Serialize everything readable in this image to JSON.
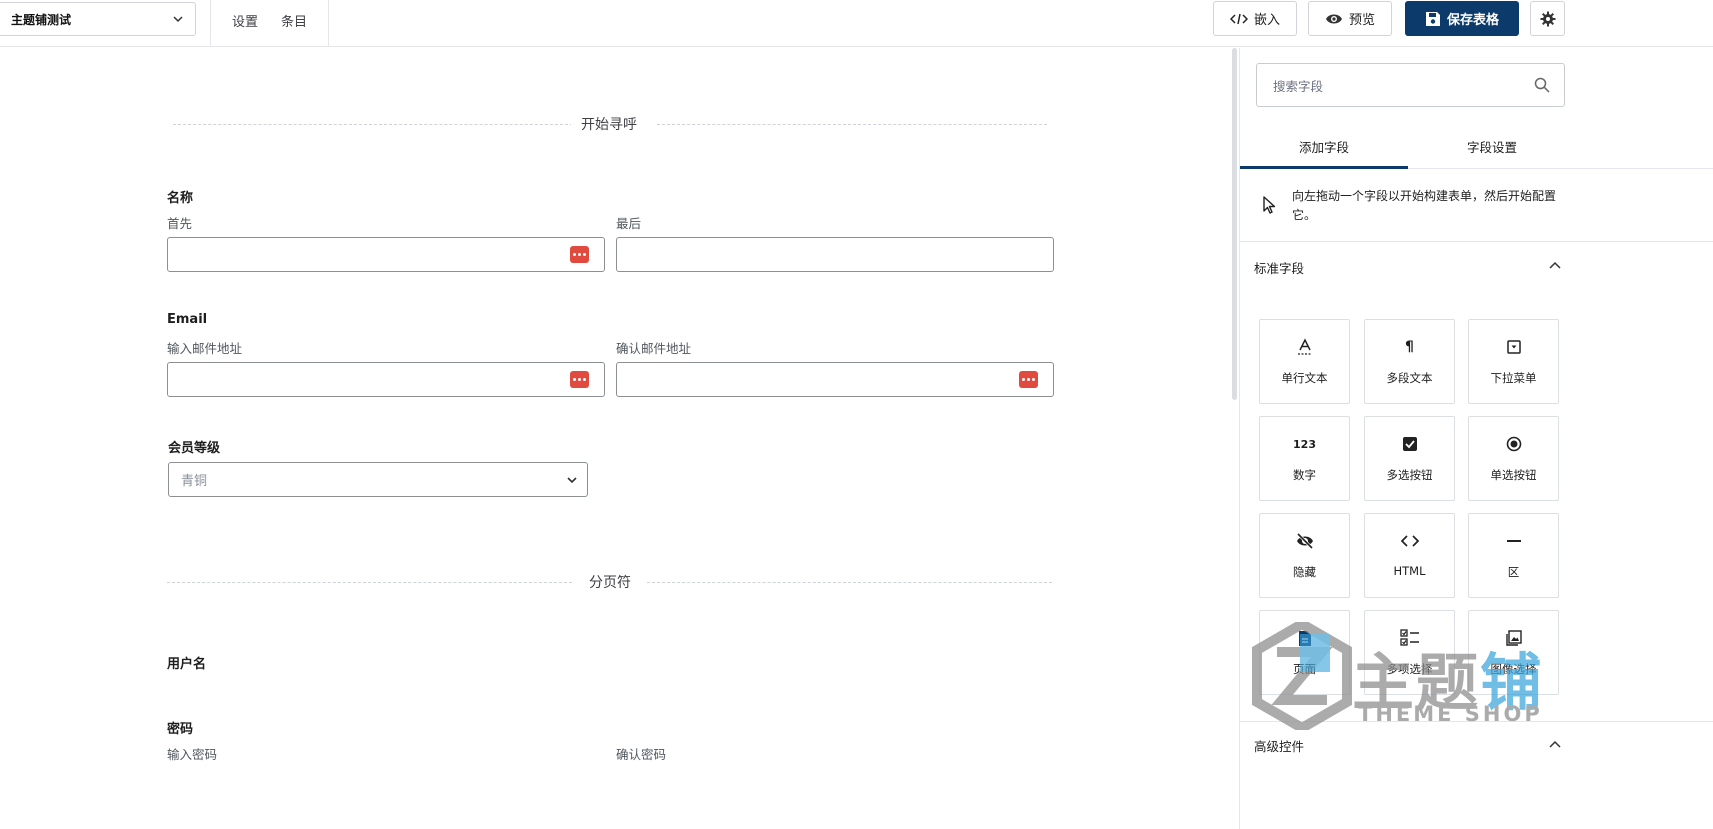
{
  "topbar": {
    "form_name": "主题铺测试",
    "nav": [
      "设置",
      "条目"
    ],
    "embed_label": "嵌入",
    "preview_label": "预览",
    "save_label": "保存表格"
  },
  "canvas": {
    "section_title": "开始寻呼",
    "name": {
      "label": "名称",
      "first": "首先",
      "last": "最后"
    },
    "email": {
      "label": "Email",
      "enter": "输入邮件地址",
      "confirm": "确认邮件地址"
    },
    "membership": {
      "label": "会员等级",
      "selected": "青铜"
    },
    "page_break": "分页符",
    "username": {
      "label": "用户名"
    },
    "password": {
      "label": "密码",
      "enter": "输入密码",
      "confirm": "确认密码"
    }
  },
  "sidebar": {
    "search_placeholder": "搜索字段",
    "tabs": [
      "添加字段",
      "字段设置"
    ],
    "hint": "向左拖动一个字段以开始构建表单，然后开始配置它。",
    "standard_title": "标准字段",
    "advanced_title": "高级控件",
    "fields": [
      {
        "label": "单行文本",
        "icon": "single-line-text-icon"
      },
      {
        "label": "多段文本",
        "icon": "paragraph-icon"
      },
      {
        "label": "下拉菜单",
        "icon": "dropdown-icon"
      },
      {
        "label": "数字",
        "icon": "number-icon",
        "glyph": "123"
      },
      {
        "label": "多选按钮",
        "icon": "checkbox-icon"
      },
      {
        "label": "单选按钮",
        "icon": "radio-icon"
      },
      {
        "label": "隐藏",
        "icon": "hidden-eye-icon"
      },
      {
        "label": "HTML",
        "icon": "code-icon"
      },
      {
        "label": "区",
        "icon": "section-icon"
      },
      {
        "label": "页面",
        "icon": "page-icon"
      },
      {
        "label": "多项选择",
        "icon": "multiple-choice-icon"
      },
      {
        "label": "图像选择",
        "icon": "image-choice-icon"
      }
    ]
  },
  "watermark": {
    "main": "主题",
    "accent": "铺",
    "sub": "THEME SHOP"
  },
  "colors": {
    "primary": "#0b3a6b",
    "alert": "#e04a3f",
    "watermark_blue": "#3aa4dc"
  }
}
